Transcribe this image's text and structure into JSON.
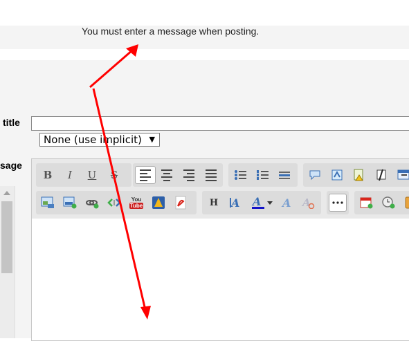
{
  "notice": {
    "error_text": "You must enter a message when posting."
  },
  "form": {
    "title_label": "title",
    "message_label": "sage",
    "title_value": "",
    "prefix_selected": "None (use implicit)"
  },
  "toolbar": {
    "bold": "B",
    "italic": "I",
    "underline": "U",
    "strike": "S",
    "youtube_top": "You",
    "youtube_bottom": "Tube",
    "heading": "H"
  },
  "colors": {
    "annotation_arrow": "#ff0000",
    "toolbar_bg": "#e9e9e9",
    "group_bg": "#dcdcdc"
  },
  "icons": [
    "align-left-icon",
    "align-center-icon",
    "align-right-icon",
    "justify-icon",
    "bullet-list-icon",
    "numbered-list-icon",
    "horizontal-rule-icon",
    "quote-icon",
    "code-icon",
    "spoiler-icon",
    "mention-icon",
    "table-icon",
    "image-icon",
    "image-upload-icon",
    "link-icon",
    "unlink-icon",
    "youtube-icon",
    "google-drive-icon",
    "pdf-icon",
    "font-size-icon",
    "font-color-icon",
    "font-family-icon",
    "remove-format-icon",
    "more-icon",
    "calendar-icon",
    "time-icon",
    "attachment-icon"
  ]
}
